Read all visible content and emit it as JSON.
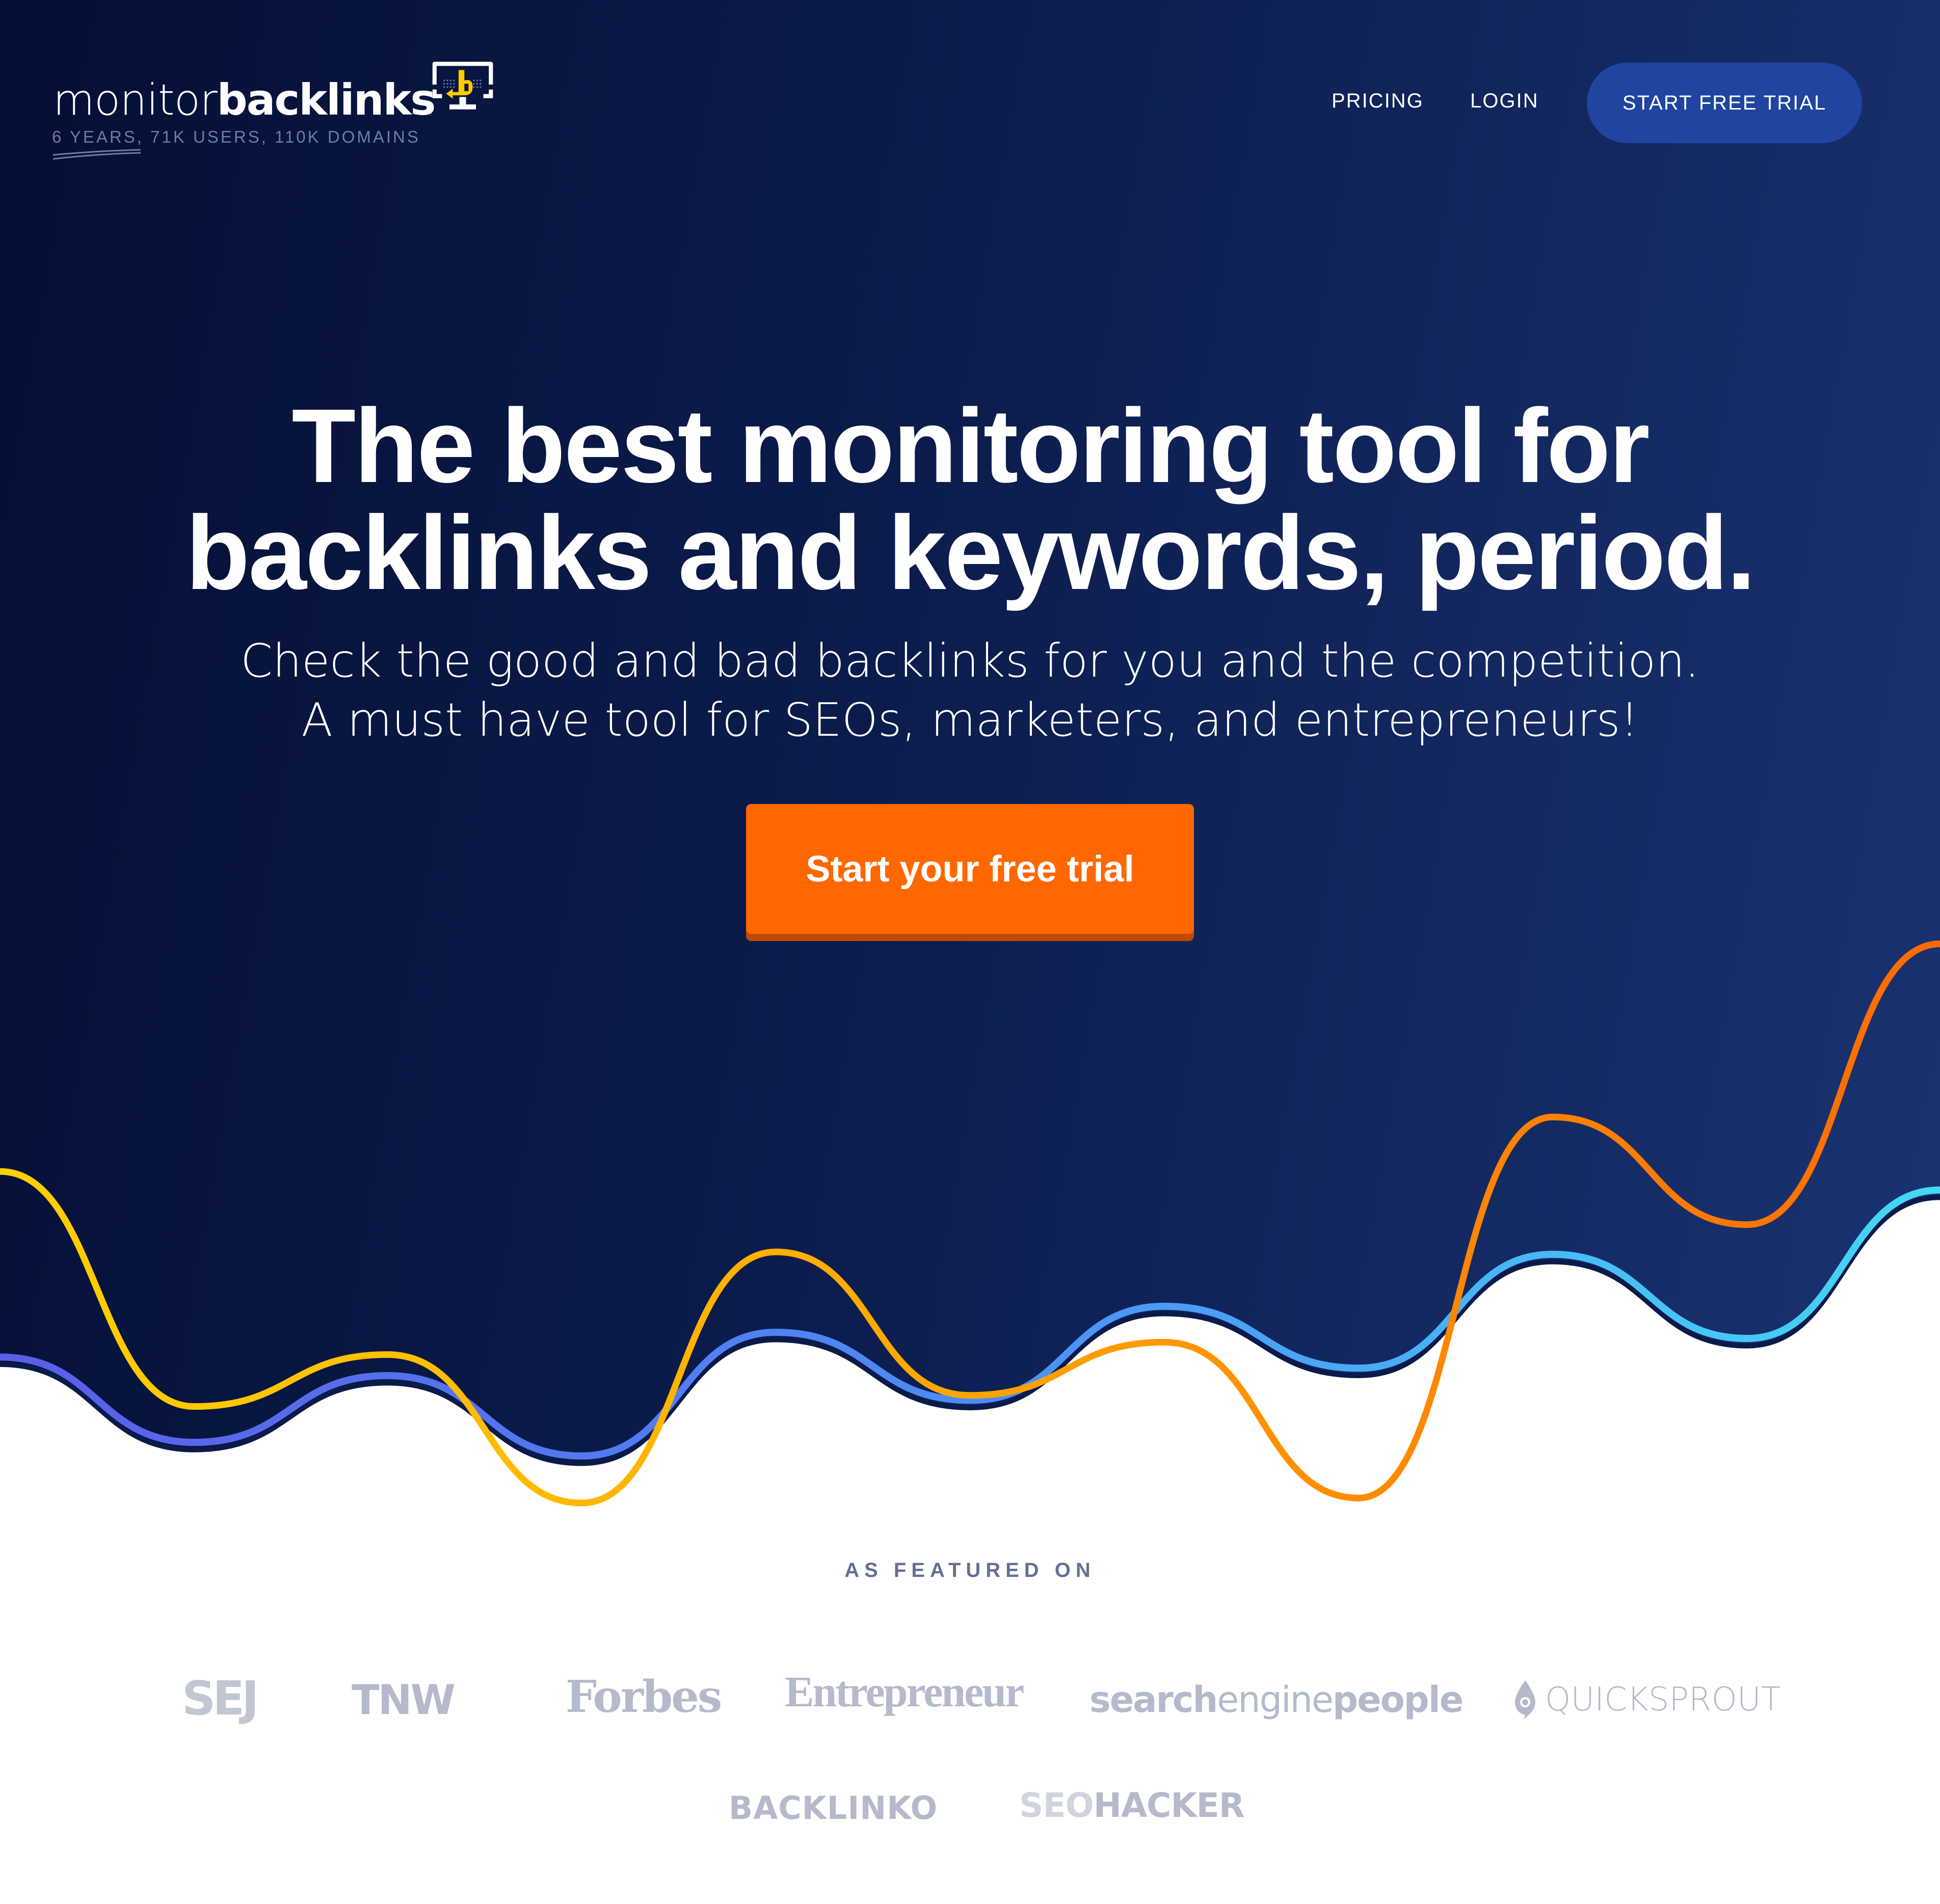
{
  "brand": {
    "name_light": "monitor",
    "name_bold": "backlinks",
    "tagline": "6 YEARS, 71K USERS, 110K DOMAINS",
    "logo_icon": "monitor-backlink-icon"
  },
  "nav": {
    "pricing": "PRICING",
    "login": "LOGIN",
    "cta": "START FREE TRIAL"
  },
  "hero": {
    "headline_line1": "The best monitoring tool for",
    "headline_line2": "backlinks and keywords, period.",
    "subtitle_line1": "Check the good and bad backlinks for you and the competition.",
    "subtitle_line2": "A must have tool for SEOs, marketers, and entrepreneurs!",
    "cta": "Start your free trial"
  },
  "featured": {
    "heading": "AS FEATURED ON",
    "logos": [
      "SEJ",
      "TNW",
      "Forbes",
      "Entrepreneur",
      "searchenginepeople",
      "QUICKSPROUT",
      "BACKLINKO",
      "SEOHACKER"
    ],
    "sep_parts": [
      "search",
      "engine",
      "people"
    ],
    "seohacker_parts": [
      "SEO",
      "HACKER"
    ]
  },
  "colors": {
    "hero_dark": "#050f35",
    "hero_light": "#1a3372",
    "nav_cta": "#1f45a0",
    "cta_orange": "#ff6700",
    "cta_shadow": "#c04a00",
    "logo_yellow": "#ffcc00",
    "featured_text": "#647093",
    "press_gray": "#b4bacb"
  }
}
